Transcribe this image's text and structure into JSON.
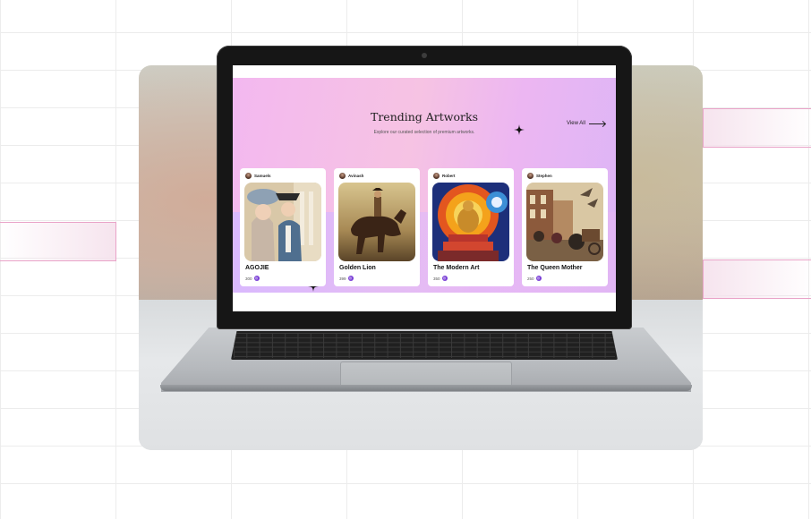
{
  "page": {
    "title": "Trending Artworks",
    "subtitle": "Explore our curated selection of premium artworks.",
    "view_all_label": "View All"
  },
  "colors": {
    "accent": "#7a3fd6",
    "hero_pink": "#f6c3e3",
    "hero_violet": "#dcb5f6"
  },
  "artworks": [
    {
      "owner": "Samuels",
      "name": "AGOJIE",
      "price": "300",
      "currency_icon": "coin-icon"
    },
    {
      "owner": "Avinash",
      "name": "Golden Lion",
      "price": "399",
      "currency_icon": "coin-icon"
    },
    {
      "owner": "Robert",
      "name": "The Modern Art",
      "price": "350",
      "currency_icon": "coin-icon"
    },
    {
      "owner": "Stephen",
      "name": "The Queen Mother",
      "price": "250",
      "currency_icon": "coin-icon"
    }
  ]
}
